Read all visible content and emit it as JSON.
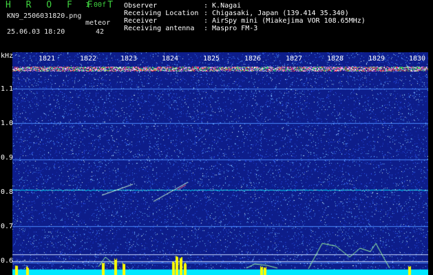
{
  "header": {
    "brand": "H R O F F T",
    "version": "1.00f",
    "filename": "KN9_2506031820.png",
    "meteor_label": "meteor",
    "meteor_count": "42",
    "datetime": "25.06.03 18:20",
    "info": [
      {
        "label": "Observer",
        "value": ": K.Nagai"
      },
      {
        "label": "Receiving Location",
        "value": ": Chigasaki, Japan (139.414 35.340)"
      },
      {
        "label": "Receiver",
        "value": ": AirSpy mini (Miakejima VOR 108.65MHz)"
      },
      {
        "label": "Receiving antenna",
        "value": ": Maspro FM-3"
      }
    ]
  },
  "spectrogram": {
    "y_unit": "kHz",
    "y_ticks": [
      "1.1",
      "1.0",
      "0.9",
      "0.8",
      "0.7",
      "0.6"
    ],
    "x_ticks": [
      "1821",
      "1822",
      "1823",
      "1824",
      "1825",
      "1826",
      "1827",
      "1828",
      "1829",
      "1830"
    ],
    "colors": {
      "background": "#0d1d8a",
      "carrier": "#00e0ff",
      "meteor": "#d0ffd0",
      "bottom_band": "#00e8ff",
      "yellow": "#ffff00"
    }
  }
}
